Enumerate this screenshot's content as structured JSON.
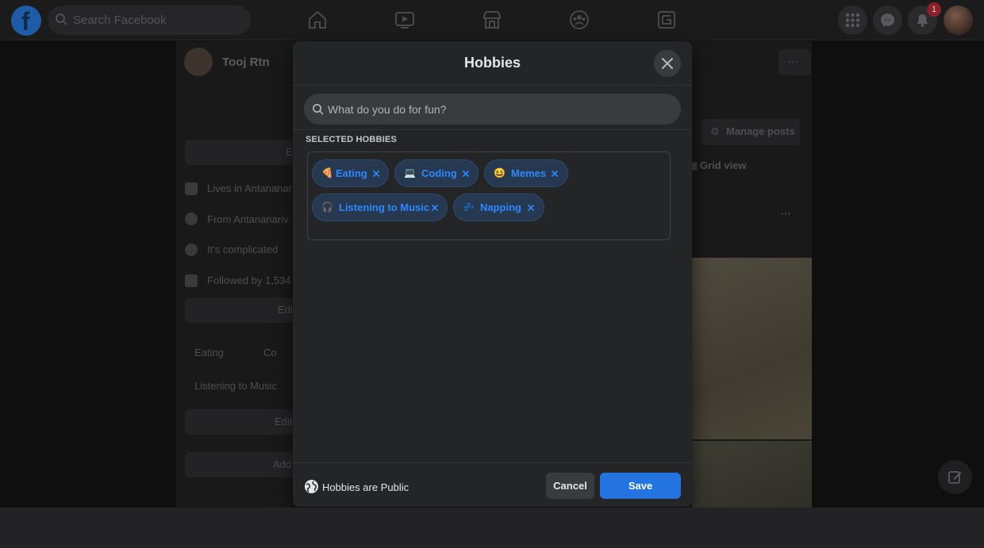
{
  "topbar": {
    "logo_letter": "f",
    "search_placeholder": "Search Facebook",
    "notification_count": "1"
  },
  "background": {
    "profile_name": "Tooj Rtn",
    "intro": {
      "lives_in": "Lives in Antananar",
      "from": "From Antananariv",
      "relationship": "It's complicated",
      "followed_by": "Followed by 1,534"
    },
    "edit_buttons": [
      "E",
      "Edi",
      "Edit",
      "Add"
    ],
    "hobbies_preview": [
      "Eating",
      "Co",
      "Listening to Music"
    ],
    "manage_posts": "Manage posts",
    "grid_view": "Grid view"
  },
  "modal": {
    "title": "Hobbies",
    "search_placeholder": "What do you do for fun?",
    "selected_label": "SELECTED HOBBIES",
    "hobbies": [
      {
        "label": "Eating",
        "emoji": "🍕"
      },
      {
        "label": "Coding",
        "emoji": "💻"
      },
      {
        "label": "Memes",
        "emoji": "😆"
      },
      {
        "label": "Listening to Music",
        "emoji": "🎧"
      },
      {
        "label": "Napping",
        "emoji": "💤"
      }
    ],
    "privacy_text": "Hobbies are Public",
    "cancel_label": "Cancel",
    "save_label": "Save"
  },
  "colors": {
    "accent": "#2374e1",
    "chip_text": "#2d88ff",
    "chip_bg": "#263951",
    "modal_bg": "#242526"
  }
}
